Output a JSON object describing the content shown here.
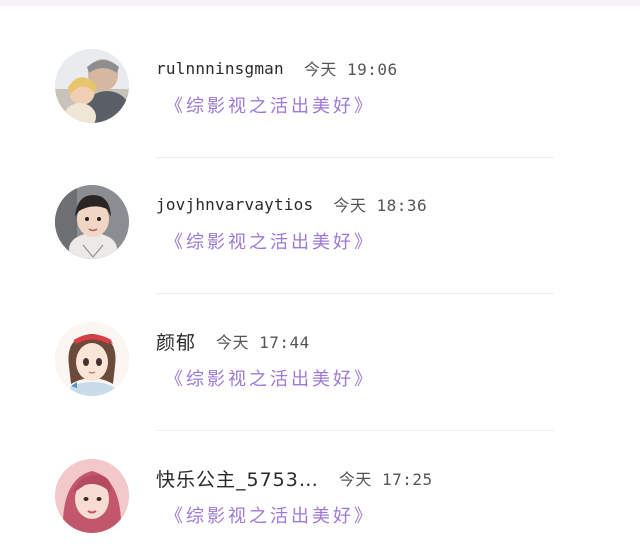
{
  "comments": [
    {
      "username": "rulnnninsgman",
      "time": "今天 19:06",
      "comment": "《综影视之活出美好》",
      "avatar_icon": "avatar-man-with-child"
    },
    {
      "username": "jovjhnvarvaytios",
      "time": "今天 18:36",
      "comment": "《综影视之活出美好》",
      "avatar_icon": "avatar-little-girl"
    },
    {
      "username": "颜郁",
      "time": "今天 17:44",
      "comment": "《综影视之活出美好》",
      "avatar_icon": "avatar-anime-girl"
    },
    {
      "username": "快乐公主_5753…",
      "time": "今天 17:25",
      "comment": "《综影视之活出美好》",
      "avatar_icon": "avatar-pink-woman"
    }
  ],
  "colors": {
    "comment_text": "#9e78d8",
    "username_text": "#2a2a2a",
    "time_text": "#555555",
    "divider": "#ededed"
  }
}
